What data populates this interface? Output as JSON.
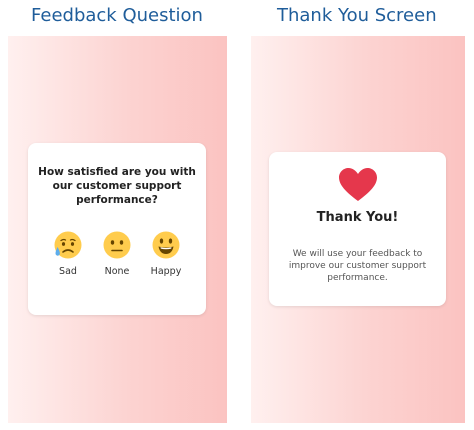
{
  "panels": {
    "left_title": "Feedback Question",
    "right_title": "Thank You Screen"
  },
  "feedback": {
    "question": "How satisfied are you with our customer support performance?",
    "options": [
      {
        "label": "Sad",
        "icon": "sad-sweat-face-icon"
      },
      {
        "label": "None",
        "icon": "neutral-face-icon"
      },
      {
        "label": "Happy",
        "icon": "happy-face-icon"
      }
    ]
  },
  "thanks": {
    "icon": "heart-icon",
    "title": "Thank You!",
    "message": "We will use your feedback to improve our customer support performance."
  },
  "colors": {
    "title_blue": "#1f5d9a",
    "gradient_light": "#fff0ef",
    "gradient_dark": "#fbc3c1",
    "emoji_yellow": "#ffcc4d",
    "emoji_feature": "#664500",
    "sweat_blue": "#5dadec",
    "heart_red": "#e5374c"
  }
}
